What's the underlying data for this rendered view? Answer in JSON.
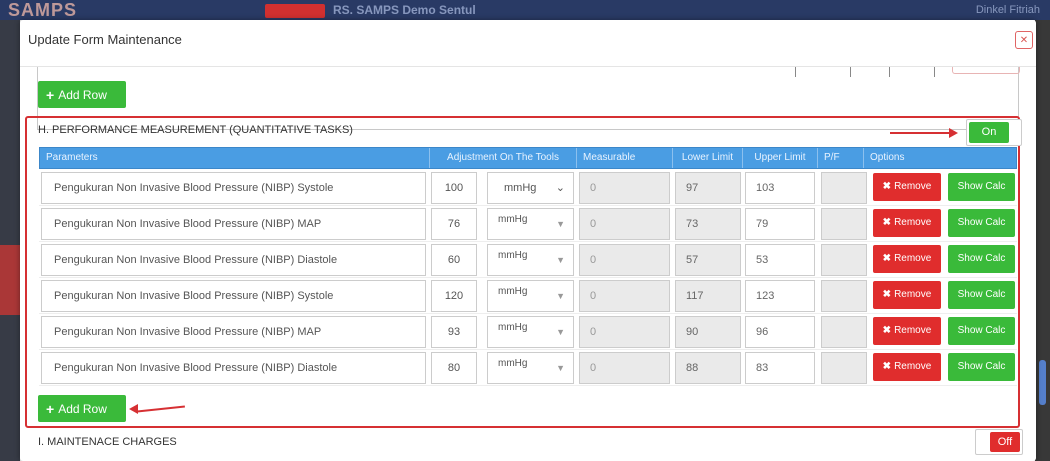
{
  "background": {
    "logo": "SAMPS",
    "hospital": "RS. SAMPS Demo Sentul",
    "user": "Dinkel Fitriah"
  },
  "modal": {
    "title": "Update Form Maintenance",
    "close_icon": "close-icon"
  },
  "previous_section": {
    "add_row_label": "Add Row"
  },
  "section_h": {
    "title": "H. PERFORMANCE MEASUREMENT (QUANTITATIVE TASKS)",
    "toggle_label": "On",
    "add_row_label": "Add Row",
    "columns": [
      "Parameters",
      "Adjustment On The Tools",
      "Measurable",
      "Lower Limit",
      "Upper Limit",
      "P/F",
      "Options"
    ],
    "rows": [
      {
        "parameter": "Pengukuran Non Invasive Blood Pressure (NIBP) Systole",
        "adjustment": "100",
        "unit": "mmHg",
        "measurable": "0",
        "lower": "97",
        "upper": "103",
        "pf": "",
        "remove": "Remove",
        "calc": "Show Calc"
      },
      {
        "parameter": "Pengukuran Non Invasive Blood Pressure (NIBP) MAP",
        "adjustment": "76",
        "unit": "mmHg",
        "measurable": "0",
        "lower": "73",
        "upper": "79",
        "pf": "",
        "remove": "Remove",
        "calc": "Show Calc"
      },
      {
        "parameter": "Pengukuran Non Invasive Blood Pressure (NIBP) Diastole",
        "adjustment": "60",
        "unit": "mmHg",
        "measurable": "0",
        "lower": "57",
        "upper": "53",
        "pf": "",
        "remove": "Remove",
        "calc": "Show Calc"
      },
      {
        "parameter": "Pengukuran Non Invasive Blood Pressure (NIBP) Systole",
        "adjustment": "120",
        "unit": "mmHg",
        "measurable": "0",
        "lower": "117",
        "upper": "123",
        "pf": "",
        "remove": "Remove",
        "calc": "Show Calc"
      },
      {
        "parameter": "Pengukuran Non Invasive Blood Pressure (NIBP) MAP",
        "adjustment": "93",
        "unit": "mmHg",
        "measurable": "0",
        "lower": "90",
        "upper": "96",
        "pf": "",
        "remove": "Remove",
        "calc": "Show Calc"
      },
      {
        "parameter": "Pengukuran Non Invasive Blood Pressure (NIBP) Diastole",
        "adjustment": "80",
        "unit": "mmHg",
        "measurable": "0",
        "lower": "88",
        "upper": "83",
        "pf": "",
        "remove": "Remove",
        "calc": "Show Calc"
      }
    ]
  },
  "section_i": {
    "title": "I. MAINTENACE CHARGES",
    "toggle_label": "Off"
  },
  "colors": {
    "accent_green": "#3aba3a",
    "danger_red": "#e02d2d",
    "header_blue": "#4a9de3",
    "highlight_red": "#d63033"
  }
}
